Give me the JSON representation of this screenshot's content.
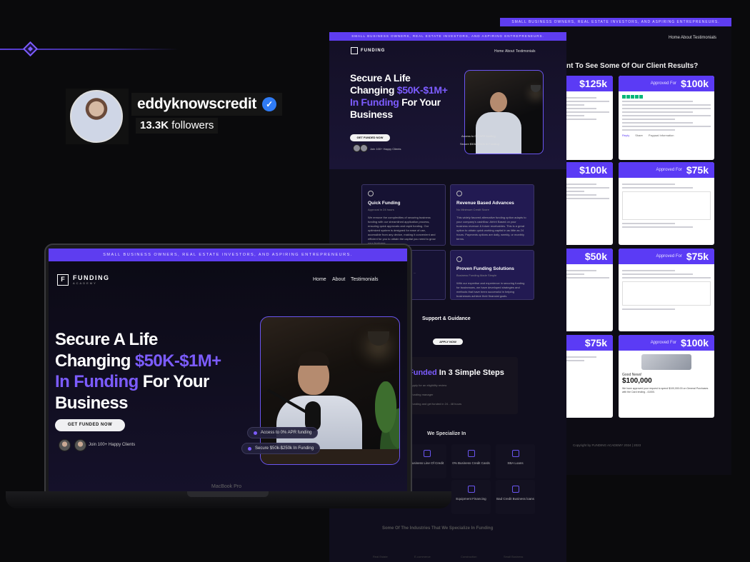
{
  "profile": {
    "username": "eddyknowscredit",
    "followers_count": "13.3K",
    "followers_label": "followers"
  },
  "site": {
    "banner": "SMALL BUSINESS OWNERS, REAL ESTATE INVESTORS, AND ASPIRING ENTREPRENEURS.",
    "logo_title": "FUNDING",
    "logo_sub": "ACADEMY",
    "nav": [
      "Home",
      "About",
      "Testimonials"
    ],
    "hero_title_1": "Secure A Life Changing ",
    "hero_title_accent": "$50K-$1M+ In Funding",
    "hero_title_2": " For Your Business",
    "hero_cta": "GET FUNDED NOW",
    "hero_happy": "Join 100+ Happy Clients",
    "pill_1": "Access to 0% APR funding",
    "pill_2": "Secure $50k-$250k In Funding"
  },
  "laptop": {
    "model_label": "MacBook Pro"
  },
  "mid_page": {
    "features": [
      {
        "title": "Quick Funding",
        "subtitle": "Approval in 24 hours",
        "body": "We remove the complexities of securing business funding with our streamlined application process, ensuring quick approvals and rapid funding. Our optimized system is designed for ease of use, accessible from any device, making it convenient and efficient for you to obtain the capital you need to grow your business."
      },
      {
        "title": "Revenue Based Advances",
        "subtitle": "No Minimum Credit Score",
        "body": "This widely favored alternative funding option adapts to your company's cashflow. Ahhh! Based on your business revenue & future receivables. This is a great option to obtain quick working capital in as little as 24 hours. Payments options are daily, weekly, or monthly terms."
      },
      {
        "title": "Proven Funding Solutions",
        "subtitle": "Business Funding Made Simple",
        "body": "With our expertise and experience in securing funding for businesses, we have developed strategies and methods that have been successful in helping businesses achieve their financial goals."
      }
    ],
    "support_title": "Support & Guidance",
    "apply_cta": "APPLY NOW",
    "steps_title_accent": "Funded",
    "steps_title": " In 3 Simple Steps",
    "steps": [
      "Apply for an eligibility review",
      "Funding manager",
      "Funding and get funded in 24 - 48 hours"
    ],
    "specialize_title": "We Specialize In",
    "specialize_items": [
      "Business Line Of Credit",
      "0% Business Credit Cards",
      "SBA Loans",
      "Equipment Financing",
      "Bad Credit Business loans"
    ],
    "industries_title": "Some Of The Industries That We Specialize In Funding",
    "industries": [
      "Real Estate",
      "E-commerce",
      "Construction",
      "Small Business"
    ]
  },
  "back_page": {
    "nav": [
      "Home",
      "About",
      "Testimonials"
    ],
    "heading": "nt To See Some Of Our Client Results?",
    "approved_label": "Approved For",
    "left_amounts": [
      "$125k",
      "$100k",
      "$50k",
      "$75k"
    ],
    "right_amounts": [
      "$100k",
      "$75k",
      "$75k",
      "$100k"
    ],
    "card_tabs": [
      "Reply",
      "Share",
      "Paypaal Information"
    ],
    "good_news": "Good News!",
    "big_amount": "$100,000",
    "approval_note": "We have approved your request to spend $100,000.00 on General Purchases with the Card ending - 41000.",
    "copyright": "Copyright by FUNDING ACADEMY 2024 | 2023"
  }
}
